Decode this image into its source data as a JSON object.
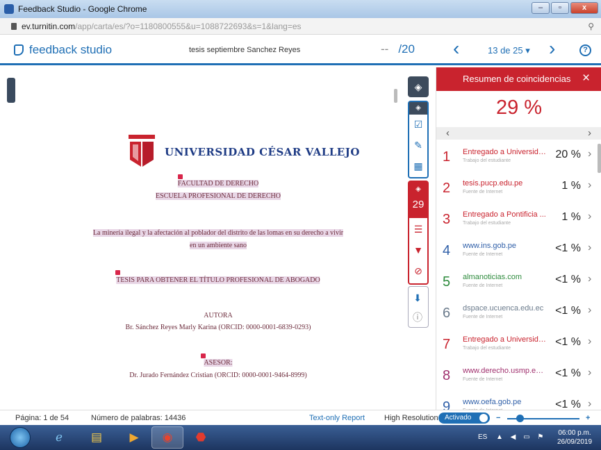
{
  "window": {
    "title": "Feedback Studio - Google Chrome",
    "controls": [
      "–",
      "▫",
      "x"
    ]
  },
  "address": {
    "host": "ev.turnitin.com",
    "path": "/app/carta/es/?o=1180800555&u=1088722693&s=1&lang=es"
  },
  "header": {
    "logo_text": "feedback studio",
    "doc_title": "tesis septiembre Sanchez Reyes",
    "grade_value": "--",
    "grade_total": "/20",
    "paper_counter": "13 de 25 ▾",
    "help_symbol": "?"
  },
  "document": {
    "university_name": "UNIVERSIDAD CÉSAR VALLEJO",
    "faculty": "FACULTAD DE DERECHO",
    "school": "ESCUELA PROFESIONAL DE DERECHO",
    "title_line1": "La minería ilegal y la afectación al poblador del distrito de las lomas en su derecho a vivir",
    "title_line2": "en un ambiente sano",
    "degree": "TESIS PARA OBTENER EL TÍTULO PROFESIONAL DE ABOGADO",
    "author_label": "AUTORA",
    "author": "Br. Sánchez Reyes Marly Karina (ORCID: 0000-0001-6839-0293)",
    "advisor_label": "ASESOR:",
    "advisor": "Dr. Jurado Fernández Cristian (ORCID: 0000-0001-9464-8999)"
  },
  "tools": {
    "match_count": "29"
  },
  "panel": {
    "title": "Resumen de coincidencias",
    "close": "×",
    "overall_percent": "29 %",
    "matches": [
      {
        "num": "1",
        "source": "Entregado a Universida...",
        "type": "Trabajo del estudiante",
        "percent": "20 %",
        "color": "#c9232e"
      },
      {
        "num": "2",
        "source": "tesis.pucp.edu.pe",
        "type": "Fuente de Internet",
        "percent": "1 %",
        "color": "#c9232e"
      },
      {
        "num": "3",
        "source": "Entregado a Pontificia ...",
        "type": "Trabajo del estudiante",
        "percent": "1 %",
        "color": "#c9232e"
      },
      {
        "num": "4",
        "source": "www.ins.gob.pe",
        "type": "Fuente de Internet",
        "percent": "<1 %",
        "color": "#2f5fa8"
      },
      {
        "num": "5",
        "source": "almanoticias.com",
        "type": "Fuente de Internet",
        "percent": "<1 %",
        "color": "#2e8b3d"
      },
      {
        "num": "6",
        "source": "dspace.ucuenca.edu.ec",
        "type": "Fuente de Internet",
        "percent": "<1 %",
        "color": "#6b7b8c"
      },
      {
        "num": "7",
        "source": "Entregado a Universida...",
        "type": "Trabajo del estudiante",
        "percent": "<1 %",
        "color": "#c9232e"
      },
      {
        "num": "8",
        "source": "www.derecho.usmp.ed...",
        "type": "Fuente de Internet",
        "percent": "<1 %",
        "color": "#a0306e"
      },
      {
        "num": "9",
        "source": "www.oefa.gob.pe",
        "type": "Fuente de Internet",
        "percent": "<1 %",
        "color": "#2f5fa8"
      }
    ]
  },
  "status": {
    "page": "Página: 1 de 54",
    "words": "Número de palabras: 14436",
    "text_only": "Text-only Report",
    "high_res": "High Resolution",
    "toggle_label": "Activado"
  },
  "taskbar": {
    "lang": "ES",
    "time": "06:00 p.m.",
    "date": "26/09/2019"
  }
}
